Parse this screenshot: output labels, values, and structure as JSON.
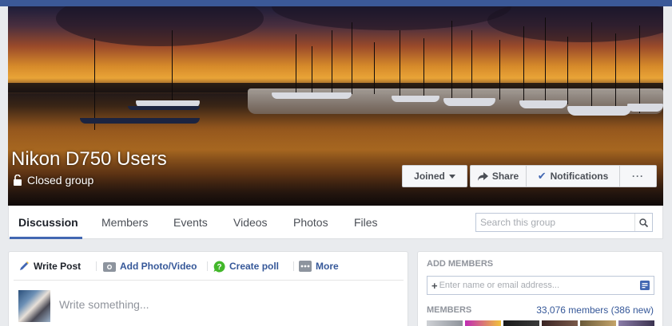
{
  "group": {
    "title": "Nikon D750 Users",
    "privacy": "Closed group"
  },
  "cover_actions": {
    "joined_label": "Joined",
    "share_label": "Share",
    "notifications_label": "Notifications",
    "more_label": "···"
  },
  "tabs": [
    {
      "label": "Discussion",
      "active": true
    },
    {
      "label": "Members"
    },
    {
      "label": "Events"
    },
    {
      "label": "Videos"
    },
    {
      "label": "Photos"
    },
    {
      "label": "Files"
    }
  ],
  "search": {
    "placeholder": "Search this group"
  },
  "composer": {
    "write_post": "Write Post",
    "add_photo": "Add Photo/Video",
    "create_poll": "Create poll",
    "more": "More",
    "placeholder": "Write something..."
  },
  "sidebar": {
    "add_members_heading": "ADD MEMBERS",
    "add_members_placeholder": "Enter name or email address...",
    "members_heading": "MEMBERS",
    "members_count": "33,076 members (386 new)"
  },
  "colors": {
    "accent": "#4267b2",
    "link": "#365899",
    "topbar": "#3b5998"
  }
}
